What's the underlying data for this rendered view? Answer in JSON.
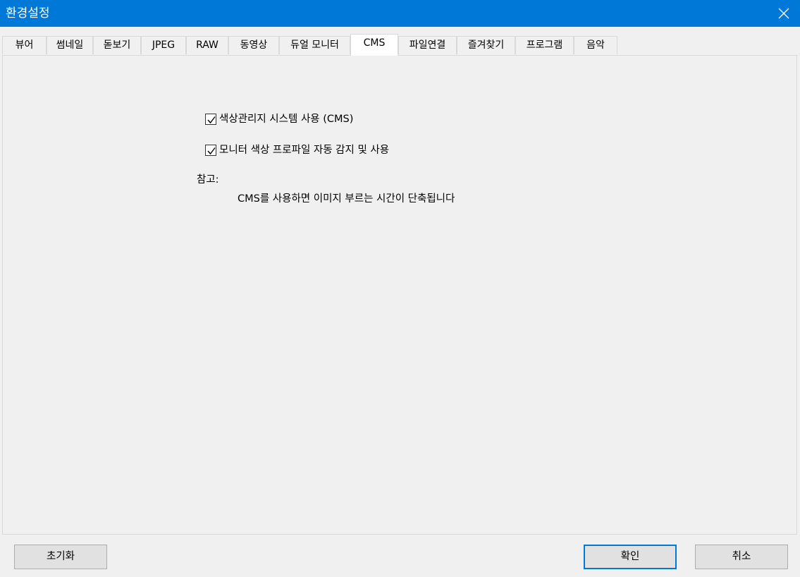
{
  "window": {
    "title": "환경설정"
  },
  "tabs": [
    {
      "label": "뷰어"
    },
    {
      "label": "썸네일"
    },
    {
      "label": "돋보기"
    },
    {
      "label": "JPEG"
    },
    {
      "label": "RAW"
    },
    {
      "label": "동영상"
    },
    {
      "label": "듀얼 모니터"
    },
    {
      "label": "CMS"
    },
    {
      "label": "파일연결"
    },
    {
      "label": "즐겨찾기"
    },
    {
      "label": "프로그램"
    },
    {
      "label": "음악"
    }
  ],
  "active_tab": "CMS",
  "cms": {
    "use_cms": {
      "label": "색상관리지 시스템 사용 (CMS)",
      "checked": true
    },
    "auto_profile": {
      "label": "모니터 색상 프로파일 자동 감지 및 사용",
      "checked": true
    },
    "note_title": "참고:",
    "note_text": "CMS를 사용하면 이미지 부르는 시간이 단축됩니다"
  },
  "buttons": {
    "reset": "초기화",
    "ok": "확인",
    "cancel": "취소"
  },
  "colors": {
    "titlebar": "#0078d7",
    "accent": "#0078d7"
  }
}
